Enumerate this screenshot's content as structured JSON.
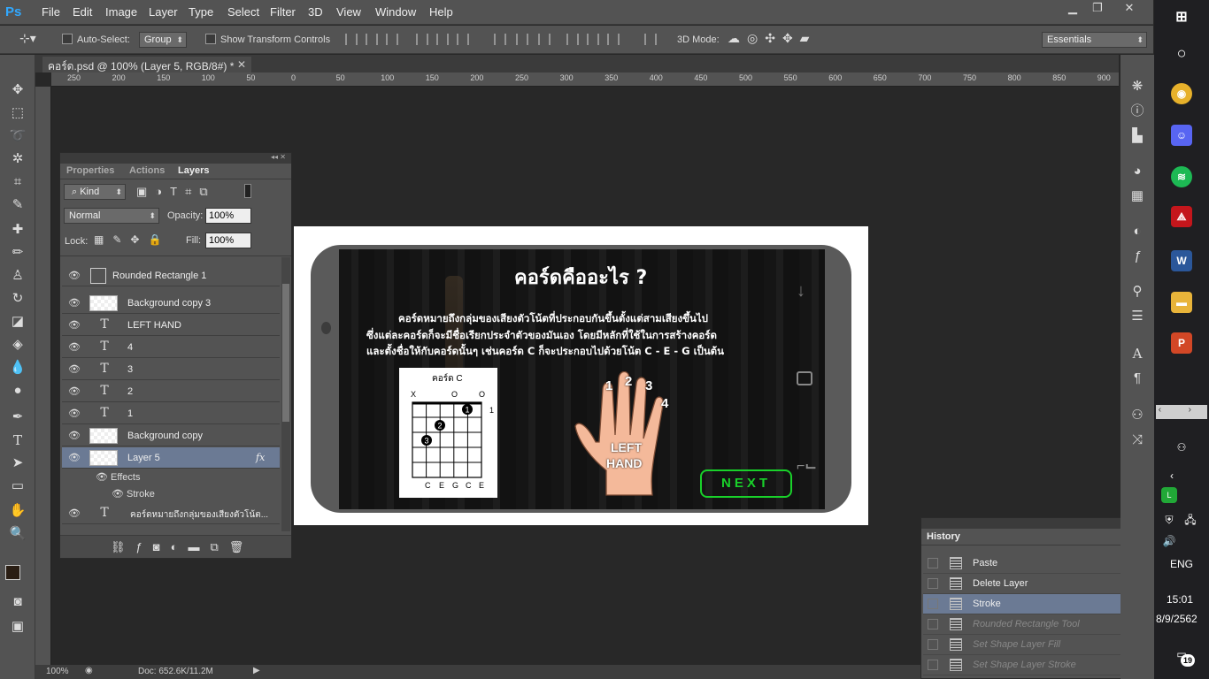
{
  "app": {
    "logo": "Ps",
    "menu": [
      "File",
      "Edit",
      "Image",
      "Layer",
      "Type",
      "Select",
      "Filter",
      "3D",
      "View",
      "Window",
      "Help"
    ]
  },
  "options": {
    "auto_select": "Auto-Select:",
    "group": "Group",
    "show_transform": "Show Transform Controls",
    "mode_3d": "3D Mode:",
    "workspace": "Essentials"
  },
  "document": {
    "tab_title": "คอร์ด.psd @ 100% (Layer 5, RGB/8#) *",
    "zoom": "100%",
    "doc_size": "Doc: 652.6K/11.2M"
  },
  "ruler": {
    "h_ticks": [
      "250",
      "200",
      "150",
      "100",
      "50",
      "0",
      "50",
      "100",
      "150",
      "200",
      "250",
      "300",
      "350",
      "400",
      "450",
      "500",
      "550",
      "600",
      "650",
      "700",
      "750",
      "800",
      "850",
      "900"
    ]
  },
  "layers_panel": {
    "tabs": [
      "Properties",
      "Actions",
      "Layers"
    ],
    "kind": "Kind",
    "blend": "Normal",
    "opacity_label": "Opacity:",
    "opacity": "100%",
    "lock_label": "Lock:",
    "fill_label": "Fill:",
    "fill": "100%",
    "layers": [
      {
        "name": "Rounded Rectangle 1",
        "type": "shape"
      },
      {
        "name": "Background copy 3",
        "type": "pixel"
      },
      {
        "name": "LEFT HAND",
        "type": "text"
      },
      {
        "name": "4",
        "type": "text"
      },
      {
        "name": "3",
        "type": "text"
      },
      {
        "name": "2",
        "type": "text"
      },
      {
        "name": "1",
        "type": "text"
      },
      {
        "name": "Background copy",
        "type": "pixel"
      },
      {
        "name": "Layer 5",
        "type": "pixel",
        "selected": true
      }
    ],
    "effects": "Effects",
    "stroke": "Stroke",
    "fx": "fx",
    "last_layer": "คอร์ดหมายถึงกลุ่มของเสียงตัวโน้ต..."
  },
  "history_panel": {
    "title": "History",
    "items": [
      {
        "name": "Paste",
        "dim": false
      },
      {
        "name": "Delete Layer",
        "dim": false
      },
      {
        "name": "Stroke",
        "dim": false,
        "selected": true
      },
      {
        "name": "Rounded Rectangle Tool",
        "dim": true
      },
      {
        "name": "Set Shape Layer Fill",
        "dim": true
      },
      {
        "name": "Set Shape Layer Stroke",
        "dim": true
      }
    ]
  },
  "artwork": {
    "title": "คอร์ดคืออะไร ?",
    "line1": "คอร์ดหมายถึงกลุ่มของเสียงตัวโน้ตที่ประกอบกันขึ้นตั้งแต่สามเสียงขึ้นไป",
    "line2": "ซึ่งแต่ละคอร์ดก็จะมีชื่อเรียกประจำตัวของมันเอง โดยมีหลักที่ใช้ในการสร้างคอร์ด",
    "line3": "และตั้งชื่อให้กับคอร์ดนั้นๆ เช่นคอร์ด C ก็จะประกอบไปด้วยโน้ต C - E - G เป็นต้น",
    "chord_title": "คอร์ด C",
    "chord_top": [
      "X",
      "O",
      "O"
    ],
    "chord_bottom": [
      "C",
      "E",
      "G",
      "C",
      "E"
    ],
    "fret_num": "1",
    "fingers": [
      "1",
      "2",
      "3",
      "4"
    ],
    "hand_label_1": "LEFT",
    "hand_label_2": "HAND",
    "next": "NEXT"
  },
  "taskbar": {
    "lang": "ENG",
    "time": "15:01",
    "date": "8/9/2562",
    "notif": "19"
  }
}
